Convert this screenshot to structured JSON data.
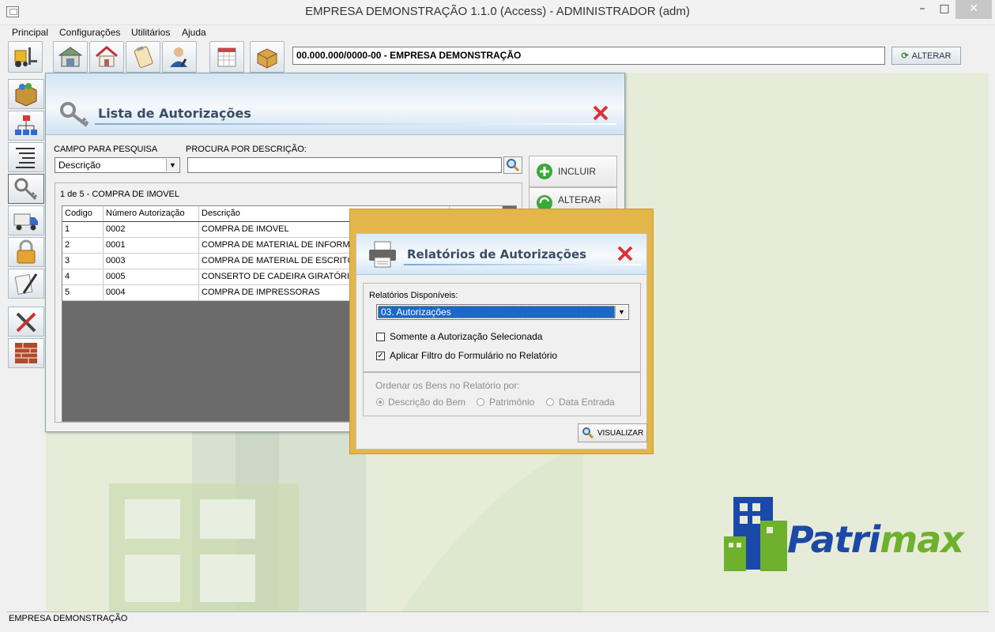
{
  "window": {
    "title": "EMPRESA DEMONSTRAÇÃO 1.1.0 (Access) - ADMINISTRADOR (adm)",
    "minimize": "–",
    "maximize": "□",
    "close": "✕"
  },
  "menu": [
    "Principal",
    "Configurações",
    "Utilitários",
    "Ajuda"
  ],
  "toolbar": {
    "company": "00.000.000/0000-00 - EMPRESA DEMONSTRAÇÃO",
    "alterar": "ALTERAR",
    "buttons": [
      "forklift-icon",
      "warehouse-icon",
      "house-icon",
      "clipboard-icon",
      "user-icon",
      "calendar-icon",
      "box-icon"
    ]
  },
  "sidebar": {
    "buttons": [
      "box-icon",
      "hierarchy-icon",
      "list-indent-icon",
      "key-icon",
      "truck-icon",
      "padlock-icon",
      "document-pen-icon",
      "tools-icon",
      "brick-wall-icon"
    ]
  },
  "lista": {
    "title": "Lista de Autorizações",
    "campo_label": "CAMPO PARA PESQUISA",
    "campo_value": "Descrição",
    "procura_label": "PROCURA POR DESCRIÇÃO:",
    "procura_value": "",
    "incluir": "INCLUIR",
    "alterar": "ALTERAR",
    "count": "1 de 5 - COMPRA DE IMOVEL",
    "columns": [
      "Codigo",
      "Número Autorização",
      "Descrição",
      ""
    ],
    "rows": [
      [
        "1",
        "0002",
        "COMPRA DE IMOVEL",
        ""
      ],
      [
        "2",
        "0001",
        "COMPRA DE MATERIAL DE INFORMÁTICA",
        ""
      ],
      [
        "3",
        "0003",
        "COMPRA DE MATERIAL DE ESCRITÓRIO",
        ""
      ],
      [
        "4",
        "0005",
        "CONSERTO DE CADEIRA GIRATÓRIA",
        ""
      ],
      [
        "5",
        "0004",
        "COMPRA DE IMPRESSORAS",
        ""
      ]
    ]
  },
  "relatorio": {
    "title": "Relatórios de Autorizações",
    "disponiveis_label": "Relatórios Disponíveis:",
    "selected": "03. Autorizações",
    "check1": {
      "label": "Somente a Autorização Selecionada",
      "checked": false
    },
    "check2": {
      "label": "Aplicar Filtro do Formulário no Relatório",
      "checked": true
    },
    "ordenar_label": "Ordenar os Bens no Relatório por:",
    "radios": [
      {
        "label": "Descrição do Bem",
        "selected": true
      },
      {
        "label": "Patrimônio",
        "selected": false
      },
      {
        "label": "Data Entrada",
        "selected": false
      }
    ],
    "visualizar": "VISUALIZAR"
  },
  "logo": {
    "text_a": "Patri",
    "text_b": "max"
  },
  "status": "EMPRESA DEMONSTRAÇÃO",
  "colors": {
    "accent_blue": "#1b49a8",
    "accent_green": "#6eb12d",
    "dialog_border": "#e4b64a",
    "close_red": "#d9343a"
  }
}
